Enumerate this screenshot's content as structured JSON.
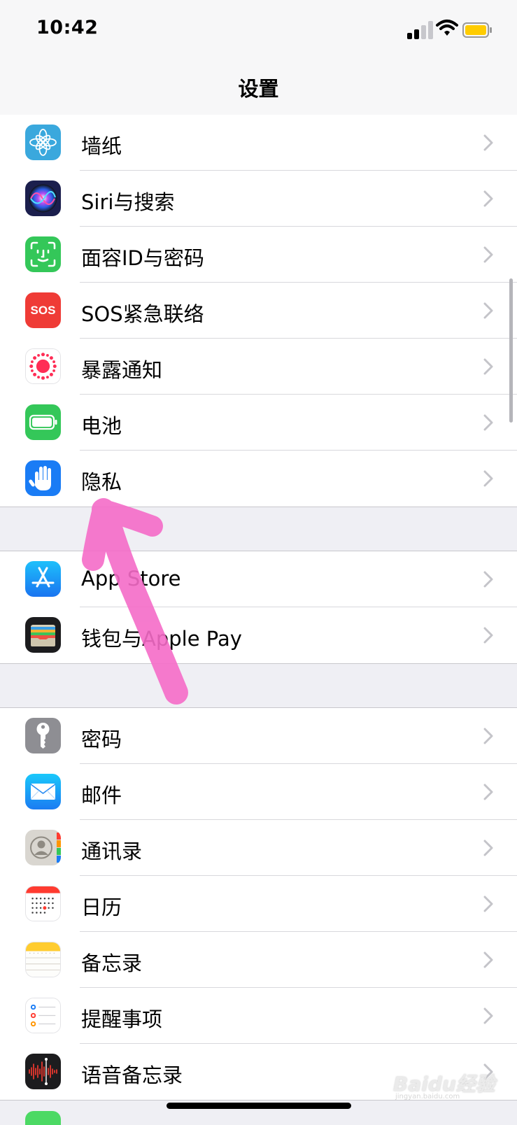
{
  "status_bar": {
    "time": "10:42"
  },
  "nav": {
    "title": "设置"
  },
  "groups": [
    {
      "items": [
        {
          "label": "墙纸",
          "icon": "wallpaper-icon"
        },
        {
          "label": "Siri与搜索",
          "icon": "siri-icon"
        },
        {
          "label": "面容ID与密码",
          "icon": "face-id-icon"
        },
        {
          "label": "SOS紧急联络",
          "icon": "sos-icon",
          "icon_text": "SOS"
        },
        {
          "label": "暴露通知",
          "icon": "exposure-notification-icon"
        },
        {
          "label": "电池",
          "icon": "battery-icon"
        },
        {
          "label": "隐私",
          "icon": "privacy-hand-icon"
        }
      ]
    },
    {
      "items": [
        {
          "label": "App Store",
          "icon": "app-store-icon"
        },
        {
          "label": "钱包与Apple Pay",
          "icon": "wallet-icon"
        }
      ]
    },
    {
      "items": [
        {
          "label": "密码",
          "icon": "key-icon"
        },
        {
          "label": "邮件",
          "icon": "mail-icon"
        },
        {
          "label": "通讯录",
          "icon": "contacts-icon"
        },
        {
          "label": "日历",
          "icon": "calendar-icon"
        },
        {
          "label": "备忘录",
          "icon": "notes-icon"
        },
        {
          "label": "提醒事项",
          "icon": "reminders-icon"
        },
        {
          "label": "语音备忘录",
          "icon": "voice-memos-icon"
        }
      ]
    }
  ],
  "watermark": {
    "text": "Baidu经验",
    "url": "jingyan.baidu.com"
  },
  "colors": {
    "wallpaper": "#3aa8dd",
    "siri": "#1b1f4d",
    "face_id": "#34c759",
    "sos": "#ef3b36",
    "exposure": "#ff2d55",
    "battery": "#34c759",
    "privacy": "#1a7cf5",
    "app_store": "#1a8cf5",
    "wallet": "#1c1c1e",
    "passwords": "#8e8e93",
    "mail": "#2f8cf5",
    "annotation_arrow": "#f56cc8"
  }
}
